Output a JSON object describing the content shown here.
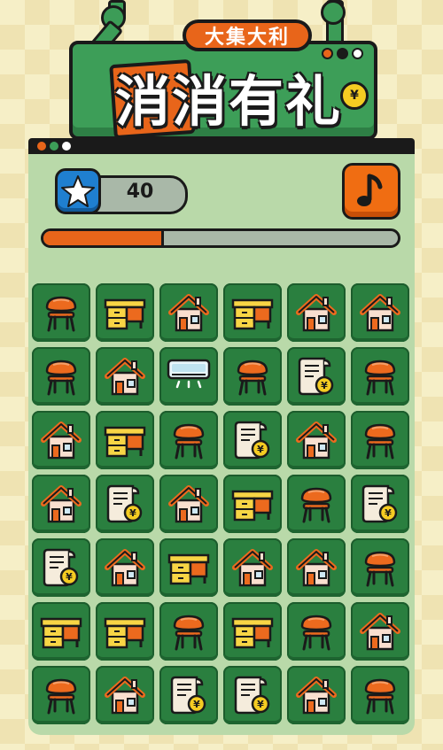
{
  "header": {
    "subtitle": "大集大利",
    "title": "消消有礼",
    "coin_symbol": "¥",
    "sign_dot_colors": [
      "#e8651a",
      "#1a1a1a",
      "#ffffff"
    ]
  },
  "panel": {
    "dot_colors": [
      "#e8651a",
      "#3d9e58",
      "#ffffff"
    ]
  },
  "hud": {
    "score_icon": "star-icon",
    "score": "40",
    "music_icon": "music-note-icon",
    "progress_fraction": 0.34
  },
  "board": {
    "columns": 6,
    "rows": [
      [
        "chair",
        "desk",
        "house",
        "desk",
        "house",
        "house"
      ],
      [
        "chair",
        "house",
        "air-conditioner",
        "chair",
        "receipt",
        "chair"
      ],
      [
        "house",
        "desk",
        "chair",
        "receipt",
        "house",
        "chair"
      ],
      [
        "house",
        "receipt",
        "house",
        "desk",
        "chair",
        "receipt"
      ],
      [
        "receipt",
        "house",
        "desk",
        "house",
        "house",
        "chair"
      ],
      [
        "desk",
        "desk",
        "chair",
        "desk",
        "chair",
        "house"
      ],
      [
        "chair",
        "house",
        "receipt",
        "receipt",
        "house",
        "chair"
      ]
    ],
    "receipt_symbol": "¥"
  },
  "colors": {
    "accent_orange": "#e8651a",
    "tile_green": "#2a7f3f",
    "panel_green": "#b9d9a9",
    "score_blue": "#1f7fd0"
  }
}
